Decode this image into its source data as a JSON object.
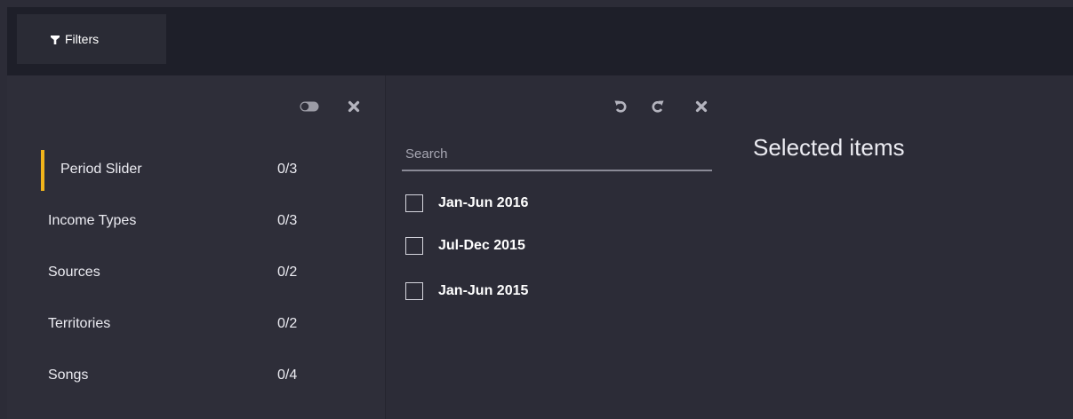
{
  "topbar": {
    "filters_tab_label": "Filters",
    "icons": {
      "filters": "funnel-icon"
    }
  },
  "left_panel": {
    "icons": {
      "toggle": "toggle-icon",
      "close": "close-icon"
    },
    "items": [
      {
        "label": "Period Slider",
        "count": "0/3",
        "active": true
      },
      {
        "label": "Income Types",
        "count": "0/3",
        "active": false
      },
      {
        "label": "Sources",
        "count": "0/2",
        "active": false
      },
      {
        "label": "Territories",
        "count": "0/2",
        "active": false
      },
      {
        "label": "Songs",
        "count": "0/4",
        "active": false
      }
    ],
    "active_color": "#f2b51b"
  },
  "middle_panel": {
    "icons": {
      "undo": "undo-icon",
      "redo": "redo-icon",
      "close": "close-icon"
    },
    "search": {
      "placeholder": "Search",
      "value": ""
    },
    "options": [
      {
        "label": "Jan-Jun 2016",
        "checked": false
      },
      {
        "label": "Jul-Dec 2015",
        "checked": false
      },
      {
        "label": "Jan-Jun 2015",
        "checked": false
      }
    ]
  },
  "right_panel": {
    "title": "Selected items"
  }
}
